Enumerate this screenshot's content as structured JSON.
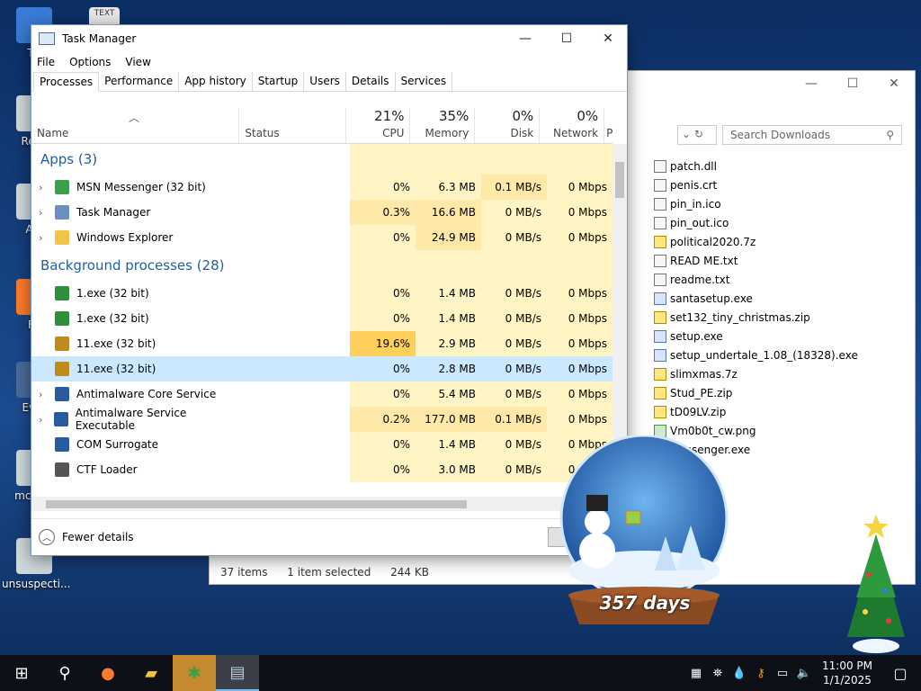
{
  "desktop": {
    "icons": [
      {
        "label": "Th"
      },
      {
        "label": "Recy"
      },
      {
        "label": "Act"
      },
      {
        "label": "Fir"
      },
      {
        "label": "Ever"
      },
      {
        "label": "mcc ga"
      },
      {
        "label": "unsuspecti..."
      }
    ],
    "text_icon_label": "TEXT"
  },
  "explorer": {
    "search_placeholder": "Search Downloads",
    "files": [
      {
        "name": "patch.dll",
        "kind": "file"
      },
      {
        "name": "penis.crt",
        "kind": "file"
      },
      {
        "name": "pin_in.ico",
        "kind": "file"
      },
      {
        "name": "pin_out.ico",
        "kind": "file"
      },
      {
        "name": "political2020.7z",
        "kind": "zip"
      },
      {
        "name": "READ ME.txt",
        "kind": "file"
      },
      {
        "name": "readme.txt",
        "kind": "file"
      },
      {
        "name": "santasetup.exe",
        "kind": "exe"
      },
      {
        "name": "set132_tiny_christmas.zip",
        "kind": "zip"
      },
      {
        "name": "setup.exe",
        "kind": "exe"
      },
      {
        "name": "setup_undertale_1.08_(18328).exe",
        "kind": "exe"
      },
      {
        "name": "slimxmas.7z",
        "kind": "zip"
      },
      {
        "name": "Stud_PE.zip",
        "kind": "zip"
      },
      {
        "name": "tD09LV.zip",
        "kind": "zip"
      },
      {
        "name": "Vm0b0t_cw.png",
        "kind": "img"
      },
      {
        "name": "Messenger.exe",
        "kind": "exe"
      }
    ],
    "status": {
      "items": "37 items",
      "selected": "1 item selected",
      "size": "244 KB"
    }
  },
  "taskmanager": {
    "title": "Task Manager",
    "menu": [
      "File",
      "Options",
      "View"
    ],
    "tabs": [
      "Processes",
      "Performance",
      "App history",
      "Startup",
      "Users",
      "Details",
      "Services"
    ],
    "active_tab": "Processes",
    "columns": {
      "name": "Name",
      "status": "Status",
      "cpu": {
        "pct": "21%",
        "label": "CPU"
      },
      "memory": {
        "pct": "35%",
        "label": "Memory"
      },
      "disk": {
        "pct": "0%",
        "label": "Disk"
      },
      "network": {
        "pct": "0%",
        "label": "Network"
      },
      "power": "P"
    },
    "groups": {
      "apps": "Apps (3)",
      "background": "Background processes (28)"
    },
    "apps": [
      {
        "name": "MSN Messenger (32 bit)",
        "cpu": "0%",
        "mem": "6.3 MB",
        "disk": "0.1 MB/s",
        "net": "0 Mbps",
        "expand": true,
        "icon": "msn-icon",
        "color": "#3aa04b"
      },
      {
        "name": "Task Manager",
        "cpu": "0.3%",
        "mem": "16.6 MB",
        "disk": "0 MB/s",
        "net": "0 Mbps",
        "expand": true,
        "icon": "taskmanager-icon",
        "color": "#6b8fbf"
      },
      {
        "name": "Windows Explorer",
        "cpu": "0%",
        "mem": "24.9 MB",
        "disk": "0 MB/s",
        "net": "0 Mbps",
        "expand": true,
        "icon": "folder-icon",
        "color": "#f3c44a"
      }
    ],
    "background": [
      {
        "name": "1.exe (32 bit)",
        "cpu": "0%",
        "mem": "1.4 MB",
        "disk": "0 MB/s",
        "net": "0 Mbps",
        "expand": false,
        "icon": "tree-icon",
        "color": "#2f8f3a"
      },
      {
        "name": "1.exe (32 bit)",
        "cpu": "0%",
        "mem": "1.4 MB",
        "disk": "0 MB/s",
        "net": "0 Mbps",
        "expand": false,
        "icon": "tree-icon",
        "color": "#2f8f3a"
      },
      {
        "name": "11.exe (32 bit)",
        "cpu": "19.6%",
        "mem": "2.9 MB",
        "disk": "0 MB/s",
        "net": "0 Mbps",
        "expand": false,
        "icon": "tree-icon",
        "color": "#c08a1e",
        "hot": true
      },
      {
        "name": "11.exe (32 bit)",
        "cpu": "0%",
        "mem": "2.8 MB",
        "disk": "0 MB/s",
        "net": "0 Mbps",
        "expand": false,
        "icon": "tree-icon",
        "color": "#c08a1e",
        "selected": true
      },
      {
        "name": "Antimalware Core Service",
        "cpu": "0%",
        "mem": "5.4 MB",
        "disk": "0 MB/s",
        "net": "0 Mbps",
        "expand": true,
        "icon": "service-icon",
        "color": "#2a5aa0"
      },
      {
        "name": "Antimalware Service Executable",
        "cpu": "0.2%",
        "mem": "177.0 MB",
        "disk": "0.1 MB/s",
        "net": "0 Mbps",
        "expand": true,
        "icon": "service-icon",
        "color": "#2a5aa0"
      },
      {
        "name": "COM Surrogate",
        "cpu": "0%",
        "mem": "1.4 MB",
        "disk": "0 MB/s",
        "net": "0 Mbps",
        "expand": false,
        "icon": "service-icon",
        "color": "#2a5aa0"
      },
      {
        "name": "CTF Loader",
        "cpu": "0%",
        "mem": "3.0 MB",
        "disk": "0 MB/s",
        "net": "0 Mbps",
        "expand": false,
        "icon": "pen-icon",
        "color": "#555"
      }
    ],
    "fewer_details": "Fewer details"
  },
  "widget": {
    "days": "357 days"
  },
  "taskbar": {
    "time": "11:00 PM",
    "date": "1/1/2025"
  }
}
